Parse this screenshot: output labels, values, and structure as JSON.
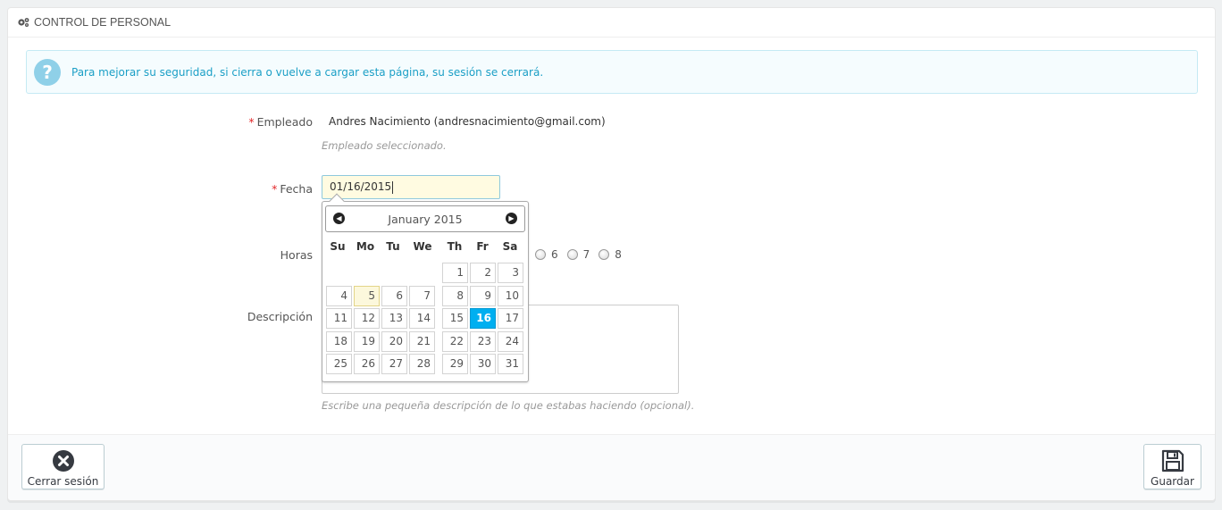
{
  "panel": {
    "title": "CONTROL DE PERSONAL",
    "title_icon": "gears-icon"
  },
  "alert": {
    "icon": "question-icon",
    "text": "Para mejorar su seguridad, si cierra o vuelve a cargar esta página, su sesión se cerrará."
  },
  "form": {
    "required_mark": "*",
    "employee": {
      "label": "Empleado",
      "value": "Andres Nacimiento (andresnacimiento@gmail.com)",
      "help": "Empleado seleccionado."
    },
    "date": {
      "label": "Fecha",
      "value": "01/16/2015"
    },
    "hours": {
      "label": "Horas",
      "visible_options": [
        "6",
        "7",
        "8"
      ]
    },
    "description": {
      "label": "Descripción",
      "value": "",
      "help": "Escribe una pequeña descripción de lo que estabas haciendo (opcional)."
    }
  },
  "datepicker": {
    "month": "January",
    "year": "2015",
    "prev_icon": "circle-arrow-left-icon",
    "next_icon": "circle-arrow-right-icon",
    "weekdays": [
      "Su",
      "Mo",
      "Tu",
      "We",
      "Th",
      "Fr",
      "Sa"
    ],
    "weeks": [
      [
        "",
        "",
        "",
        "",
        "1",
        "2",
        "3"
      ],
      [
        "4",
        "5",
        "6",
        "7",
        "8",
        "9",
        "10"
      ],
      [
        "11",
        "12",
        "13",
        "14",
        "15",
        "16",
        "17"
      ],
      [
        "18",
        "19",
        "20",
        "21",
        "22",
        "23",
        "24"
      ],
      [
        "25",
        "26",
        "27",
        "28",
        "29",
        "30",
        "31"
      ]
    ],
    "today": "5",
    "selected": "16",
    "colors": {
      "selected": "#00aff0",
      "today": "#fcf8dc"
    }
  },
  "footer": {
    "logout_label": "Cerrar sesión",
    "logout_icon": "close-circle-icon",
    "save_label": "Guardar",
    "save_icon": "floppy-disk-icon"
  }
}
